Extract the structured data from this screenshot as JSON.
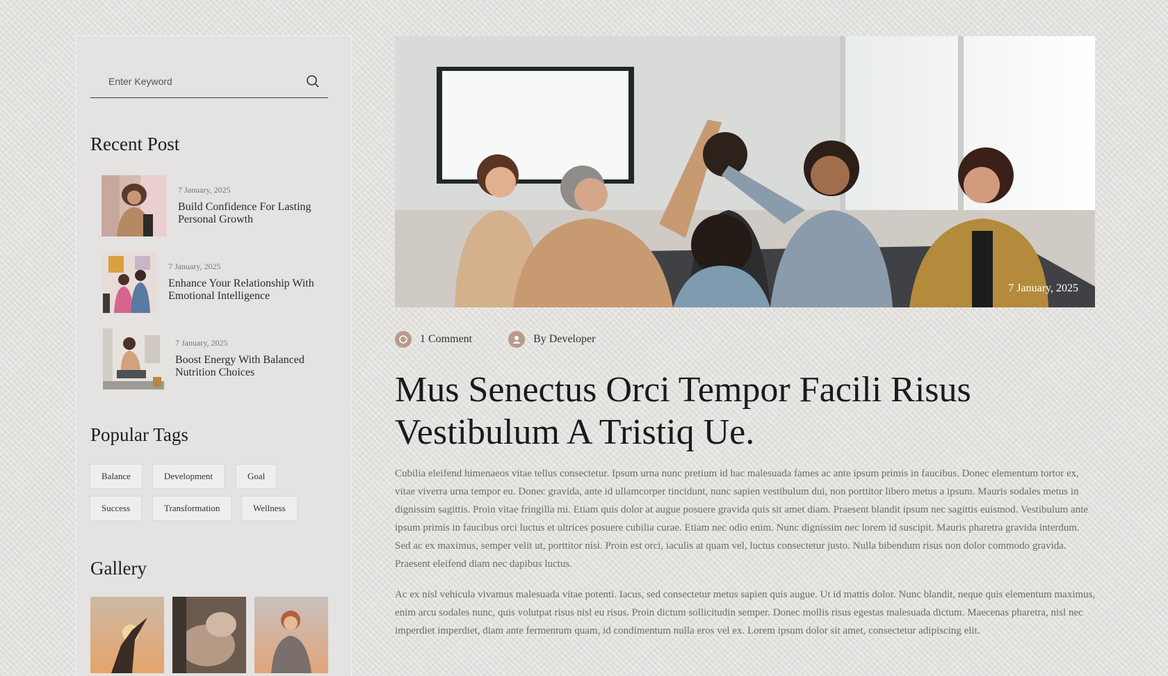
{
  "sidebar": {
    "search": {
      "placeholder": "Enter Keyword"
    },
    "recent_post": {
      "title": "Recent Post",
      "items": [
        {
          "date": "7 January, 2025",
          "title": "Build Confidence For Lasting Personal Growth"
        },
        {
          "date": "7 January, 2025",
          "title": "Enhance Your Relationship With Emotional Intelligence"
        },
        {
          "date": "7 January, 2025",
          "title": "Boost Energy With Balanced Nutrition Choices"
        }
      ]
    },
    "popular_tags": {
      "title": "Popular Tags",
      "tags": [
        "Balance",
        "Development",
        "Goal",
        "Success",
        "Transformation",
        "Wellness"
      ]
    },
    "gallery": {
      "title": "Gallery"
    }
  },
  "post": {
    "image_date": "7 January, 2025",
    "meta": {
      "comments": "1 Comment",
      "author": "By Developer"
    },
    "title": "Mus Senectus Orci Tempor Facili Risus Vestibulum A Tristiq Ue.",
    "paragraphs": [
      "Cubilia eleifend himenaeos vitae tellus consectetur. Ipsum urna nunc pretium id hac malesuada fames ac ante ipsum primis in faucibus. Donec elementum tortor ex, vitae viverra urna tempor eu. Donec gravida, ante id ullamcorper tincidunt, nunc sapien vestibulum dui, non porttitor libero metus a ipsum. Mauris sodales metus in dignissim sagittis. Proin vitae fringilla mi. Etiam quis dolor at augue posuere gravida quis sit amet diam. Praesent blandit ipsum nec sagittis euismod. Vestibulum ante ipsum primis in faucibus orci luctus et ultrices posuere cubilia curae. Etiam nec odio enim. Nunc dignissim nec lorem id suscipit. Mauris pharetra gravida interdum. Sed ac ex maximus, semper velit ut, porttitor nisi. Proin est orci, iaculis at quam vel, luctus consectetur justo. Nulla bibendum risus non dolor commodo gravida. Praesent eleifend diam nec dapibus luctus.",
      "Ac ex nisl vehicula vivamus malesuada vitae potenti. Iacus, sed consectetur metus sapien quis augue. Ut id mattis dolor. Nunc blandit, neque quis elementum maximus, enim arcu sodales nunc, quis volutpat risus nisl eu risus. Proin dictum sollicitudin semper. Donec mollis risus egestas malesuada dictum. Maecenas pharetra, nisl nec imperdiet imperdiet, diam ante fermentum quam, id condimentum nulla eros vel ex. Lorem ipsum dolor sit amet, consectetur adipiscing elit."
    ]
  },
  "icons": {
    "search": "search-icon",
    "comment": "comment-icon",
    "author": "user-icon"
  },
  "colors": {
    "page_bg": "#e3e1de",
    "sidebar_bg": "#e4e3e1",
    "accent": "#b89b8c",
    "heading": "#1a1a1a",
    "body_text": "#6d6a67"
  }
}
